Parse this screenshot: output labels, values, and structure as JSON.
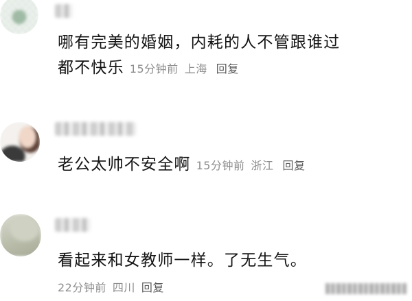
{
  "comments": [
    {
      "text_line1": "哪有完美的婚姻，内耗的人不管跟谁过",
      "text_line2": "都不快乐",
      "time": "15分钟前",
      "location": "上海",
      "reply": "回复"
    },
    {
      "text": "老公太帅不安全啊",
      "time": "15分钟前",
      "location": "浙江",
      "reply": "回复"
    },
    {
      "text": "看起来和女教师一样。了无生气。",
      "time": "22分钟前",
      "location": "四川",
      "reply": "回复"
    }
  ],
  "colors": {
    "text": "#151515",
    "meta": "#8d8d8d",
    "reply": "#5b5b5b"
  },
  "icons": [
    "avatar-1",
    "avatar-2",
    "avatar-3",
    "watermark"
  ]
}
